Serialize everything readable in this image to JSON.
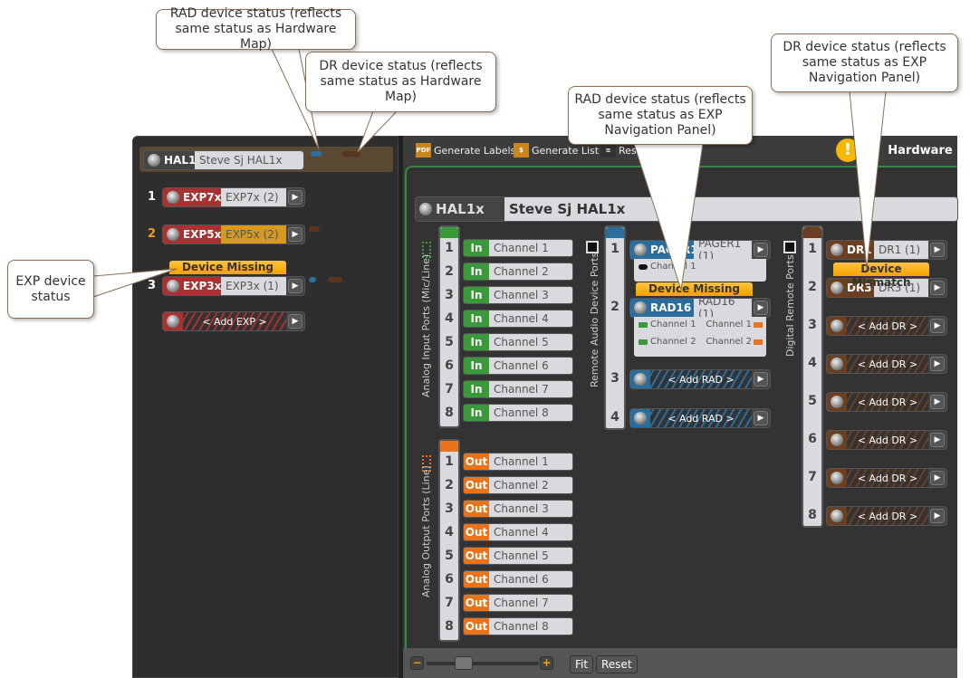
{
  "colors": {
    "exp": "#a83232",
    "rad": "#2a6e9e",
    "dr": "#6b3f22",
    "in": "#3a9a3a",
    "out": "#e8731a",
    "warning": "#f5a000",
    "accent_border": "#2f8a3e"
  },
  "callouts": [
    {
      "text": "RAD device status (reflects same status as Hardware Map)"
    },
    {
      "text": "DR device status (reflects same status as Hardware Map)"
    },
    {
      "text": "RAD device status (reflects same status as EXP Navigation Panel)"
    },
    {
      "text": "DR device status (reflects same status as EXP Navigation Panel)"
    },
    {
      "text": "EXP device status"
    }
  ],
  "nav": {
    "hal": {
      "tag": "HAL1x",
      "name": "Steve Sj HAL1x"
    },
    "exps": [
      {
        "num": "1",
        "tag": "EXP7x",
        "name": "EXP7x (2)",
        "status": ""
      },
      {
        "num": "2",
        "tag": "EXP5x",
        "name": "EXP5x (2)",
        "status": ""
      },
      {
        "num": "3",
        "tag": "EXP3x",
        "name": "EXP3x (1)",
        "status": "Device Missing"
      }
    ],
    "add_exp": "< Add EXP >"
  },
  "toolbar": {
    "generate_labels": "Generate Labels",
    "generate_labels_icon": "PDF",
    "generate_list": "Generate List",
    "generate_list_icon": "$",
    "reset": "Res",
    "tab": "Hardware"
  },
  "hal": {
    "tag": "HAL1x",
    "name": "Steve Sj HAL1x"
  },
  "inputs": {
    "label": "Analog Input Ports (Mic/Line)",
    "badge": "In",
    "channels": [
      "Channel 1",
      "Channel 2",
      "Channel 3",
      "Channel 4",
      "Channel 5",
      "Channel 6",
      "Channel 7",
      "Channel 8"
    ]
  },
  "outputs": {
    "label": "Analog Output Ports (Line)",
    "badge": "Out",
    "channels": [
      "Channel 1",
      "Channel 2",
      "Channel 3",
      "Channel 4",
      "Channel 5",
      "Channel 6",
      "Channel 7",
      "Channel 8"
    ]
  },
  "rad": {
    "label": "Remote Audio Device Ports",
    "ports": [
      {
        "num": "1",
        "tag": "PAGER1",
        "name": "PAGER1 (1)",
        "status": "",
        "channels_left": [
          "Channel 1"
        ],
        "channels_right": []
      },
      {
        "num": "2",
        "tag": "RAD16",
        "name": "RAD16 (1)",
        "status": "Device Missing",
        "channels_left": [
          "Channel 1",
          "Channel 2"
        ],
        "channels_right": [
          "Channel 1",
          "Channel 2"
        ]
      },
      {
        "num": "3",
        "add": "< Add RAD >"
      },
      {
        "num": "4",
        "add": "< Add RAD >"
      }
    ]
  },
  "dr": {
    "label": "Digital Remote Ports",
    "ports": [
      {
        "num": "1",
        "tag": "DR1",
        "name": "DR1 (1)",
        "status": ""
      },
      {
        "num": "2",
        "tag": "DR3",
        "name": "DR3 (1)",
        "status": "Device Mismatch"
      },
      {
        "num": "3",
        "add": "< Add DR >"
      },
      {
        "num": "4",
        "add": "< Add DR >"
      },
      {
        "num": "5",
        "add": "< Add DR >"
      },
      {
        "num": "6",
        "add": "< Add DR >"
      },
      {
        "num": "7",
        "add": "< Add DR >"
      },
      {
        "num": "8",
        "add": "< Add DR >"
      }
    ]
  },
  "zoom": {
    "level": 0.3,
    "fit": "Fit",
    "reset": "Reset"
  }
}
